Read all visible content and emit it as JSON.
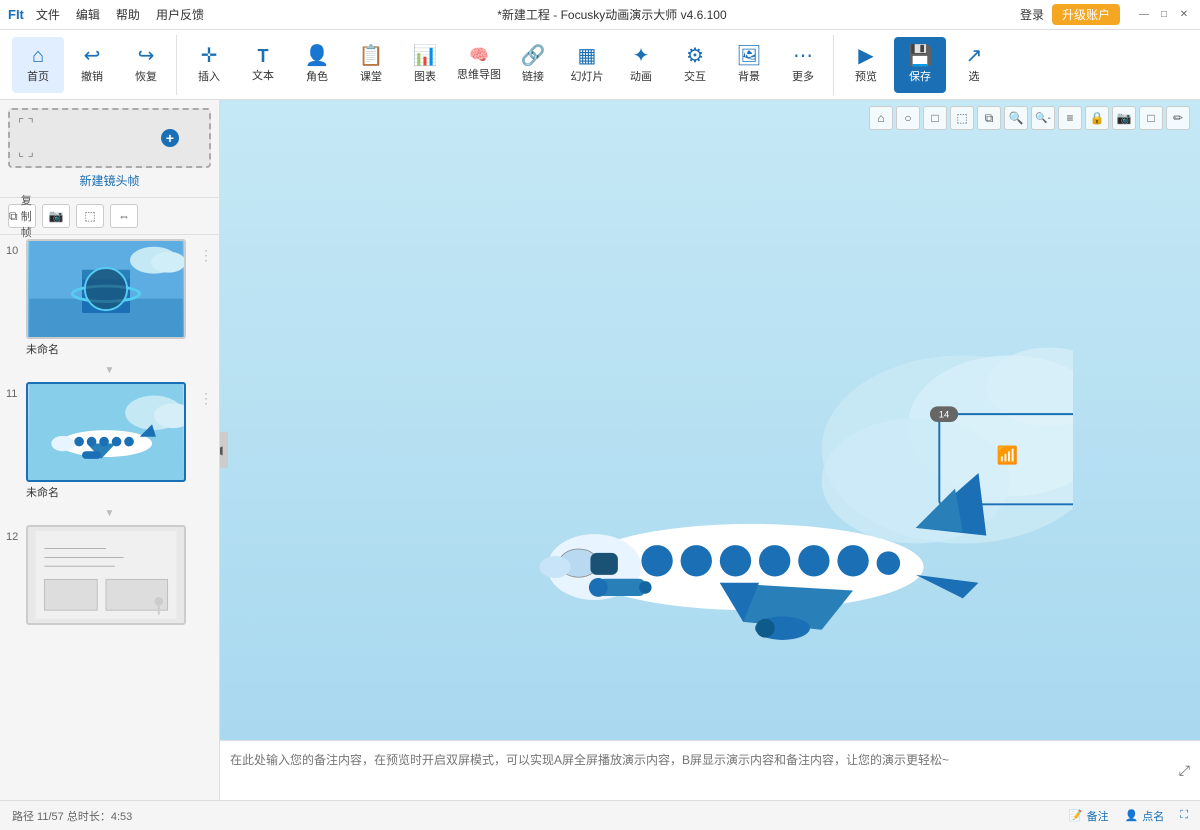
{
  "titlebar": {
    "logo": "FIt",
    "menus": [
      "文件",
      "编辑",
      "帮助",
      "用户反馈"
    ],
    "title": "*新建工程 - Focusky动画演示大师 v4.6.100",
    "login": "登录",
    "upgrade": "升级账户"
  },
  "toolbar": {
    "groups": [
      {
        "items": [
          {
            "id": "home",
            "icon": "⌂",
            "label": "首页"
          },
          {
            "id": "undo",
            "icon": "↩",
            "label": "撤销"
          },
          {
            "id": "redo",
            "icon": "↪",
            "label": "恢复"
          }
        ]
      },
      {
        "items": [
          {
            "id": "insert",
            "icon": "✛",
            "label": "插入"
          },
          {
            "id": "text",
            "icon": "T",
            "label": "文本"
          },
          {
            "id": "character",
            "icon": "👤",
            "label": "角色"
          },
          {
            "id": "class",
            "icon": "⬛",
            "label": "课堂"
          },
          {
            "id": "chart",
            "icon": "📊",
            "label": "图表"
          },
          {
            "id": "mindmap",
            "icon": "🧠",
            "label": "思维导图"
          },
          {
            "id": "link",
            "icon": "🔗",
            "label": "链接"
          },
          {
            "id": "slides",
            "icon": "🎞",
            "label": "幻灯片"
          },
          {
            "id": "animation",
            "icon": "✦",
            "label": "动画"
          },
          {
            "id": "interact",
            "icon": "🖱",
            "label": "交互"
          },
          {
            "id": "background",
            "icon": "🖼",
            "label": "背景"
          },
          {
            "id": "more",
            "icon": "⋯",
            "label": "更多"
          }
        ]
      },
      {
        "items": [
          {
            "id": "preview",
            "icon": "▶",
            "label": "预览"
          },
          {
            "id": "save",
            "icon": "💾",
            "label": "保存",
            "highlight": true
          },
          {
            "id": "select",
            "icon": "↗",
            "label": "选"
          }
        ]
      }
    ]
  },
  "sidebar": {
    "new_frame_label": "新建镜头帧",
    "controls": [
      "复制帧",
      "📷",
      "🔲",
      "↔"
    ],
    "slides": [
      {
        "number": "10",
        "name": "未命名",
        "type": "globe"
      },
      {
        "number": "11",
        "name": "未命名",
        "type": "airplane",
        "active": true
      },
      {
        "number": "12",
        "name": "",
        "type": "sketch"
      }
    ]
  },
  "canvas": {
    "selection_badge": "14",
    "counter": "11/57",
    "zoom_tools": [
      "⌂",
      "○",
      "□",
      "□",
      "□",
      "🔍+",
      "🔍-",
      "≡",
      "🔒",
      "📷",
      "□",
      "✏"
    ]
  },
  "notes": {
    "placeholder": "在此处输入您的备注内容，在预览时开启双屏模式，可以实现A屏全屏播放演示内容，B屏显示演示内容和备注内容，让您的演示更轻松~"
  },
  "statusbar": {
    "path": "路径 11/57  总时长：4:53",
    "notes_btn": "备注",
    "dotname_btn": "点名"
  }
}
